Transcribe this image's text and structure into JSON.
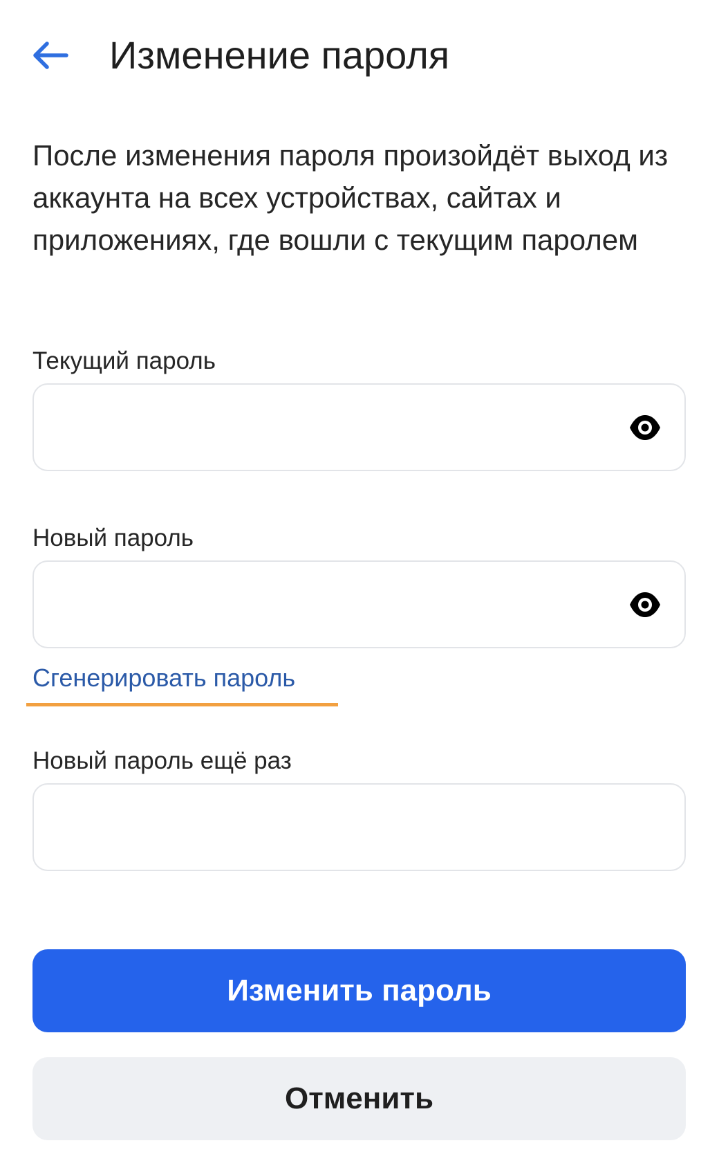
{
  "header": {
    "title": "Изменение пароля",
    "back_icon": "arrow-left-icon"
  },
  "description": "После изменения пароля произойдёт выход из аккаунта на всех устройствах, сайтах и приложениях, где вошли с текущим паролем",
  "fields": {
    "current_password": {
      "label": "Текущий пароль",
      "value": "",
      "icon": "eye-icon"
    },
    "new_password": {
      "label": "Новый пароль",
      "value": "",
      "icon": "eye-icon"
    },
    "generate_link": "Сгенерировать пароль",
    "repeat_password": {
      "label": "Новый пароль ещё раз",
      "value": ""
    }
  },
  "actions": {
    "submit_label": "Изменить пароль",
    "cancel_label": "Отменить"
  },
  "colors": {
    "accent": "#2563eb",
    "back_arrow": "#2f6fe0",
    "link": "#2b5aa8",
    "link_underline": "#f2a040",
    "field_border": "#e2e4e8",
    "secondary_button_bg": "#eef0f3"
  }
}
